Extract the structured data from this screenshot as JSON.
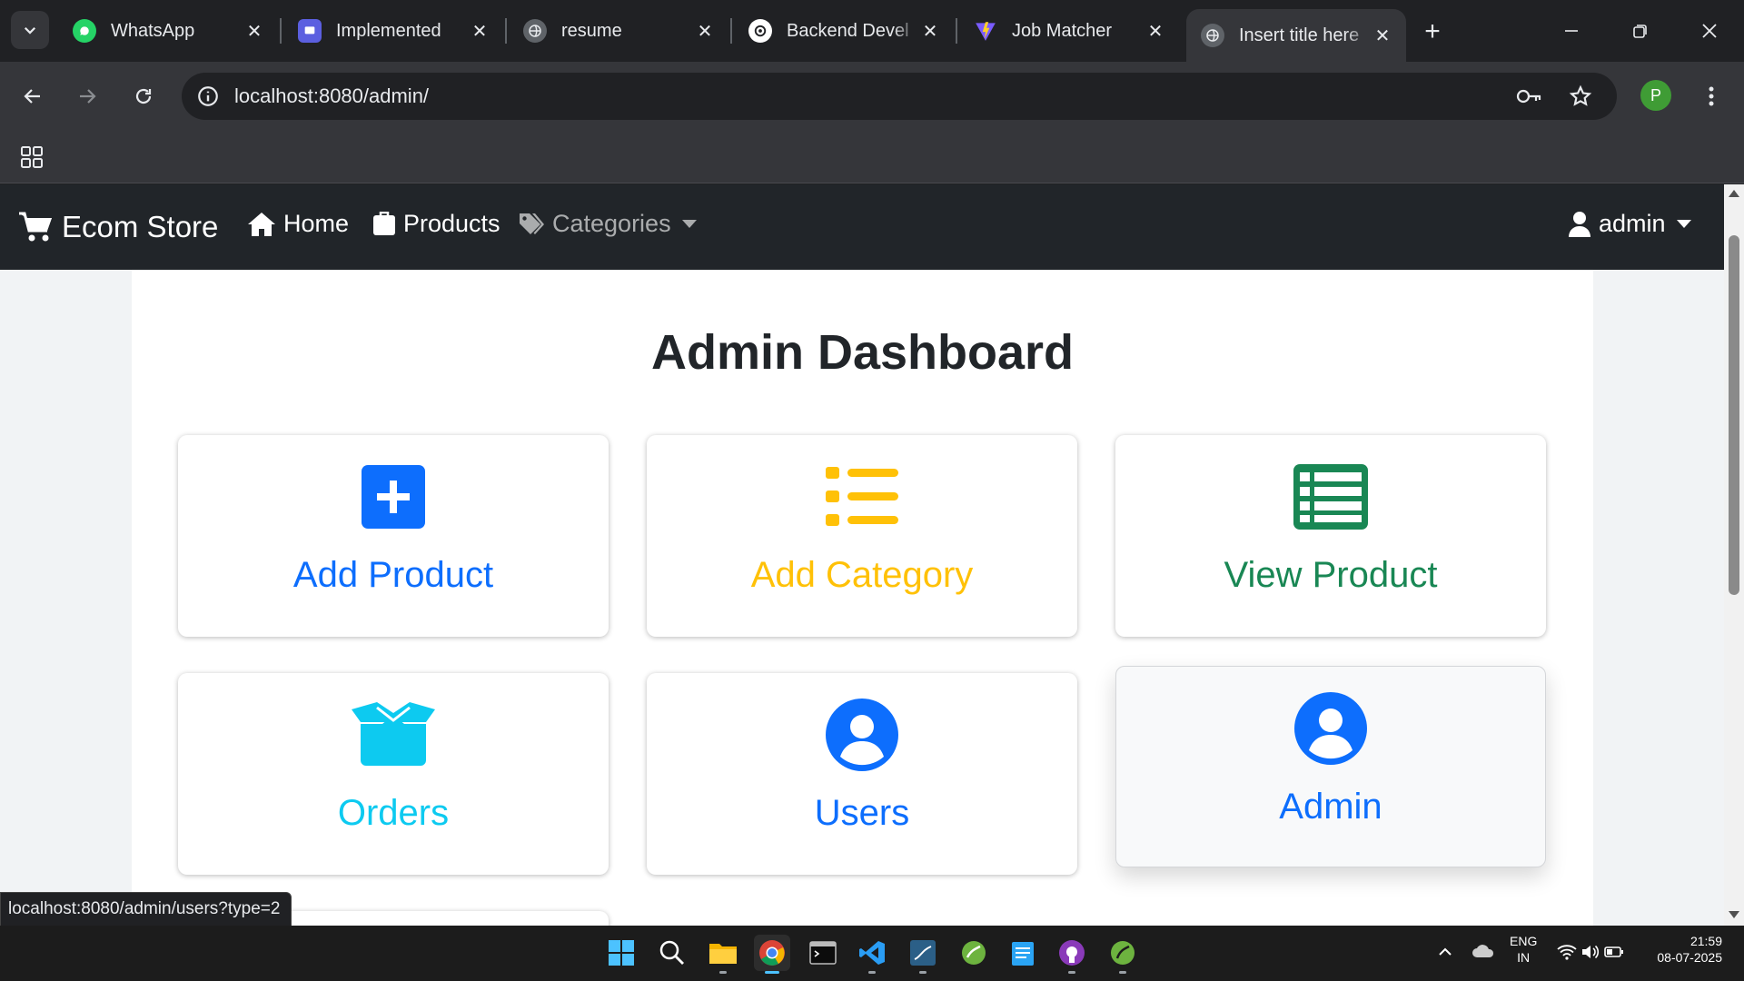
{
  "browser": {
    "tabs": [
      {
        "title": "WhatsApp",
        "icon": "whatsapp-icon"
      },
      {
        "title": "Implemented",
        "icon": "app-icon"
      },
      {
        "title": "resume",
        "icon": "globe-icon"
      },
      {
        "title": "Backend Devel",
        "icon": "openai-icon"
      },
      {
        "title": "Job Matcher",
        "icon": "vite-icon"
      },
      {
        "title": "Insert title here",
        "icon": "globe-icon",
        "active": true
      }
    ],
    "url_host": "localhost",
    "url_rest": ":8080/admin/",
    "profile_initial": "P"
  },
  "navbar": {
    "brand": "Ecom Store",
    "links": {
      "home": "Home",
      "products": "Products",
      "categories": "Categories"
    },
    "user": "admin"
  },
  "page": {
    "title": "Admin Dashboard",
    "cards": [
      {
        "label": "Add Product",
        "color": "#0d6efd",
        "icon": "plus-square-icon"
      },
      {
        "label": "Add Category",
        "color": "#ffc107",
        "icon": "list-icon"
      },
      {
        "label": "View Product",
        "color": "#198754",
        "icon": "table-list-icon"
      },
      {
        "label": "Orders",
        "color": "#0dcaf0",
        "icon": "box-open-icon"
      },
      {
        "label": "Users",
        "color": "#0d6efd",
        "icon": "user-circle-icon"
      },
      {
        "label": "Admin",
        "color": "#0d6efd",
        "icon": "user-circle-icon"
      }
    ]
  },
  "status_bar_url": "localhost:8080/admin/users?type=2",
  "taskbar": {
    "lang_top": "ENG",
    "lang_bottom": "IN",
    "time": "21:59",
    "date": "08-07-2025"
  }
}
